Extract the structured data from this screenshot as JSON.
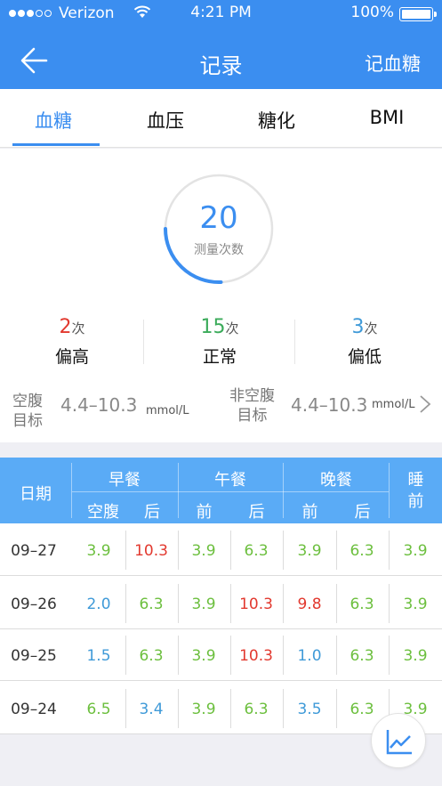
{
  "status_bar": {
    "carrier": "Verizon",
    "time": "4:21 PM",
    "battery": "100%"
  },
  "nav": {
    "title": "记录",
    "action": "记血糖"
  },
  "tabs": [
    "血糖",
    "血压",
    "糖化",
    "BMI"
  ],
  "summary": {
    "count": "20",
    "count_label": "测量次数",
    "high": {
      "count": "2",
      "unit": "次",
      "label": "偏高"
    },
    "normal": {
      "count": "15",
      "unit": "次",
      "label": "正常"
    },
    "low": {
      "count": "3",
      "unit": "次",
      "label": "偏低"
    },
    "fasting_target": {
      "label_line1": "空腹",
      "label_line2": "目标",
      "range": "4.4–10.3",
      "unit": "mmol/L"
    },
    "nonfasting_target": {
      "label_line1": "非空腹",
      "label_line2": "目标",
      "range": "4.4–10.3",
      "unit": "mmol/L"
    }
  },
  "table": {
    "date_header": "日期",
    "groups": [
      "早餐",
      "午餐",
      "晚餐"
    ],
    "sub_headers": [
      "空腹",
      "后",
      "前",
      "后",
      "前",
      "后"
    ],
    "bedtime_line1": "睡",
    "bedtime_line2": "前",
    "rows": [
      {
        "date": "09–27",
        "values": [
          "3.9",
          "10.3",
          "3.9",
          "6.3",
          "3.9",
          "6.3",
          "3.9"
        ],
        "status": [
          "n",
          "h",
          "n",
          "n",
          "n",
          "n",
          "n"
        ]
      },
      {
        "date": "09–26",
        "values": [
          "2.0",
          "6.3",
          "3.9",
          "10.3",
          "9.8",
          "6.3",
          "3.9"
        ],
        "status": [
          "l",
          "n",
          "n",
          "h",
          "h",
          "n",
          "n"
        ]
      },
      {
        "date": "09–25",
        "values": [
          "1.5",
          "6.3",
          "3.9",
          "10.3",
          "1.0",
          "6.3",
          "3.9"
        ],
        "status": [
          "l",
          "n",
          "n",
          "h",
          "l",
          "n",
          "n"
        ]
      },
      {
        "date": "09–24",
        "values": [
          "6.5",
          "3.4",
          "3.9",
          "6.3",
          "3.5",
          "6.3",
          "3.9"
        ],
        "status": [
          "n",
          "l",
          "n",
          "n",
          "l",
          "n",
          "n"
        ]
      }
    ]
  },
  "colors": {
    "accent": "#3b8ef0",
    "high": "#e2392f",
    "normal": "#6cbf3e",
    "low": "#3f9ad8"
  }
}
